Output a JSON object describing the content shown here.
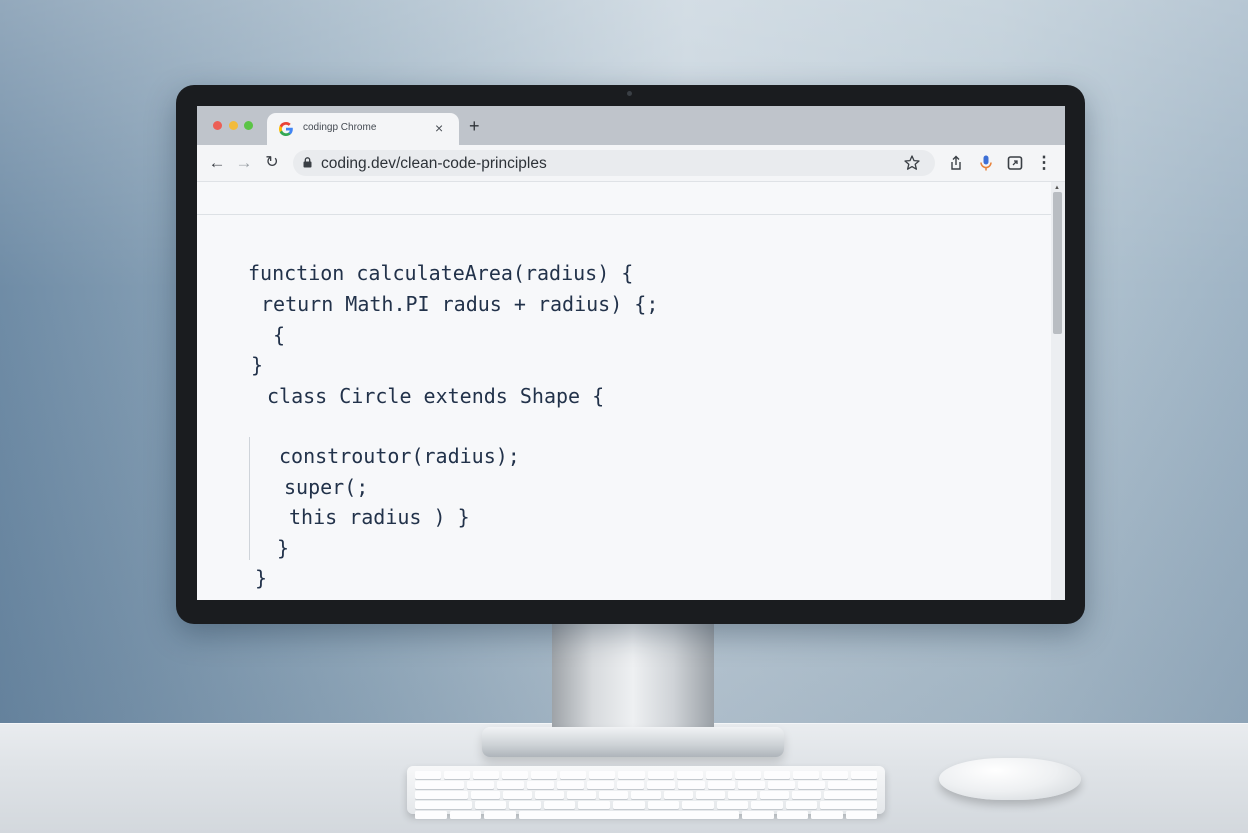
{
  "browser": {
    "tab": {
      "title": "codingp Chrome",
      "close_symbol": "×"
    },
    "new_tab_symbol": "+",
    "nav": {
      "back": "←",
      "forward": "→",
      "reload": "↻"
    },
    "address_bar": {
      "url": "coding.dev/clean-code-principles"
    },
    "menu_symbol": "⋮"
  },
  "code": {
    "lines": [
      "function calculateArea(radius) {",
      "return Math.PI radus + radius) {;",
      "{",
      "}",
      "class Circle extends Shape {",
      "constroutor(radius);",
      "super(;",
      "this radius ) }",
      "}",
      "}"
    ]
  },
  "colors": {
    "traffic_red": "#ec5f56",
    "traffic_yellow": "#f2bb3b",
    "traffic_green": "#5bc446",
    "code_text": "#22324a",
    "mic_accent": "#e8823a"
  }
}
